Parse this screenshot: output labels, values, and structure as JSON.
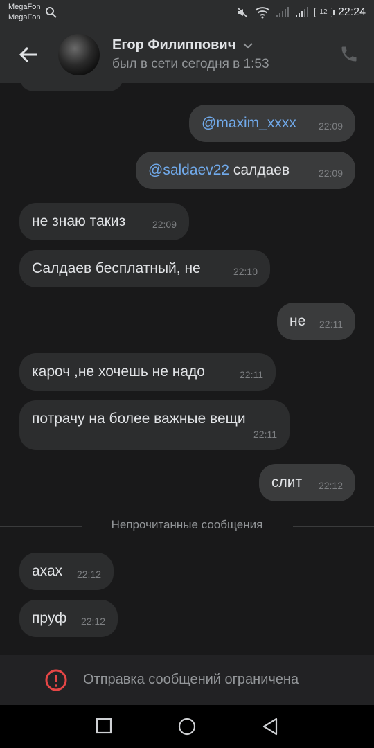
{
  "status_bar": {
    "carrier_1": "MegaFon",
    "carrier_2": "MegaFon",
    "battery": "12",
    "time": "22:24"
  },
  "header": {
    "name": "Егор Филиппович",
    "status": "был в сети сегодня в 1:53"
  },
  "messages": [
    {
      "dir": "out",
      "mention": "@maxim_xxxx",
      "text": "",
      "time": "22:09"
    },
    {
      "dir": "out",
      "mention": "@saldaev22",
      "text": " салдаев",
      "time": "22:09"
    },
    {
      "dir": "in",
      "text": "не знаю такиз",
      "time": "22:09"
    },
    {
      "dir": "in",
      "text": "Салдаев бесплатный, не",
      "time": "22:10"
    },
    {
      "dir": "out",
      "text": "не",
      "time": "22:11"
    },
    {
      "dir": "in",
      "text": "кароч ,не хочешь не надо",
      "time": "22:11"
    },
    {
      "dir": "in",
      "text": "потрачу на более важные вещи",
      "time": "22:11"
    },
    {
      "dir": "out",
      "text": "слит",
      "time": "22:12"
    },
    {
      "dir": "in",
      "text": "ахах",
      "time": "22:12"
    },
    {
      "dir": "in",
      "text": "пруф",
      "time": "22:12"
    }
  ],
  "unread_divider": "Непрочитанные сообщения",
  "footer": {
    "restricted_text": "Отправка сообщений ограничена"
  },
  "colors": {
    "background": "#19191a",
    "bar": "#2c2d2e",
    "incoming_bubble": "#2c2d2e",
    "outgoing_bubble": "#3a3b3c",
    "mention": "#71aaeb",
    "warning": "#e64646"
  }
}
